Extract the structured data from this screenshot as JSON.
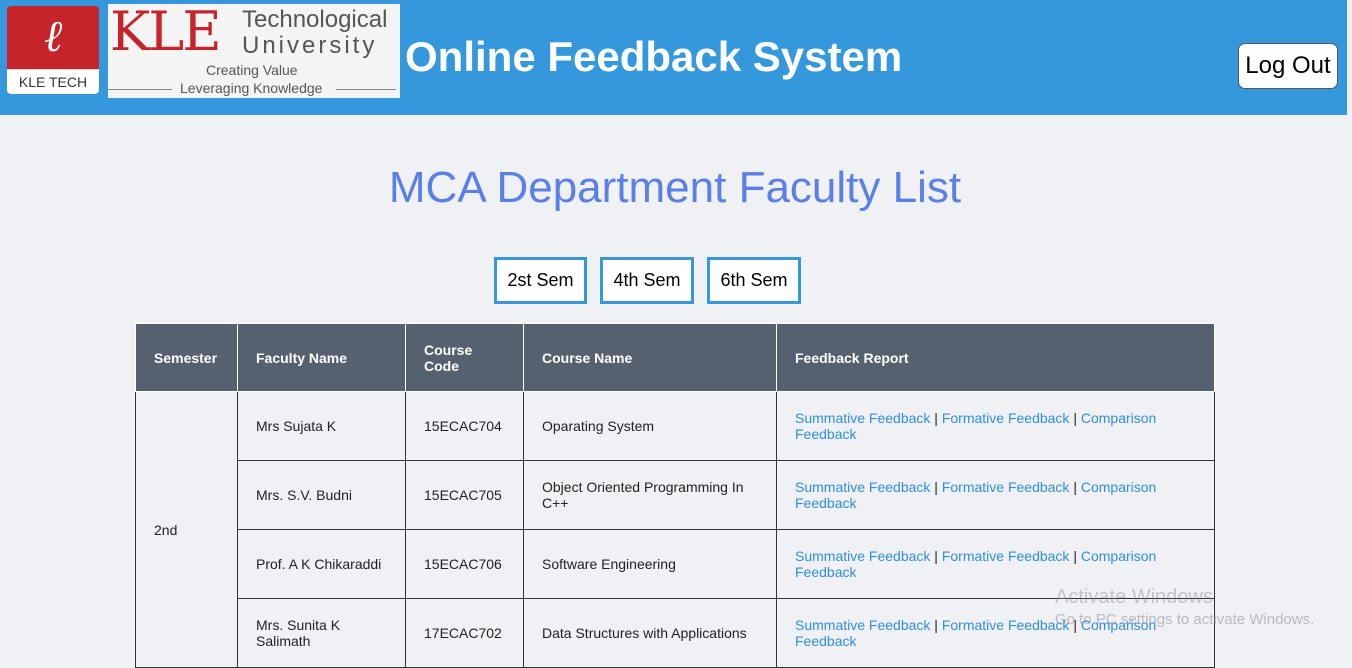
{
  "header": {
    "logo_badge_mark": "ℓ",
    "logo_badge_text": "KLE TECH",
    "logo_kle": "KLE",
    "logo_technological": "Technological",
    "logo_university": "University",
    "logo_tagline_1": "Creating Value",
    "logo_tagline_2": "Leveraging Knowledge",
    "app_title": "Online Feedback System",
    "logout_label": "Log Out",
    "background_color": "#3598dc",
    "brand_red": "#c5242b"
  },
  "page": {
    "title": "MCA Department Faculty List",
    "title_color": "#5b7fe8"
  },
  "semester_buttons": [
    "2st Sem",
    "4th Sem",
    "6th Sem"
  ],
  "table": {
    "headers": {
      "semester": "Semester",
      "faculty_name": "Faculty Name",
      "course_code": "Course Code",
      "course_name": "Course Name",
      "feedback_report": "Feedback Report"
    },
    "semester_value": "2nd",
    "link_labels": {
      "summative": "Summative Feedback",
      "formative": "Formative Feedback",
      "comparison": "Comparison Feedback",
      "separator": "|"
    },
    "rows": [
      {
        "faculty": "Mrs Sujata K",
        "code": "15ECAC704",
        "course": "Oparating System"
      },
      {
        "faculty": "Mrs. S.V. Budni",
        "code": "15ECAC705",
        "course": "Object Oriented Programming In C++"
      },
      {
        "faculty": "Prof. A K Chikaraddi",
        "code": "15ECAC706",
        "course": "Software Engineering"
      },
      {
        "faculty": "Mrs. Sunita K Salimath",
        "code": "17ECAC702",
        "course": "Data Structures with Applications"
      }
    ]
  },
  "watermark": {
    "line1": "Activate Windows",
    "line2": "Go to PC settings to activate Windows."
  }
}
